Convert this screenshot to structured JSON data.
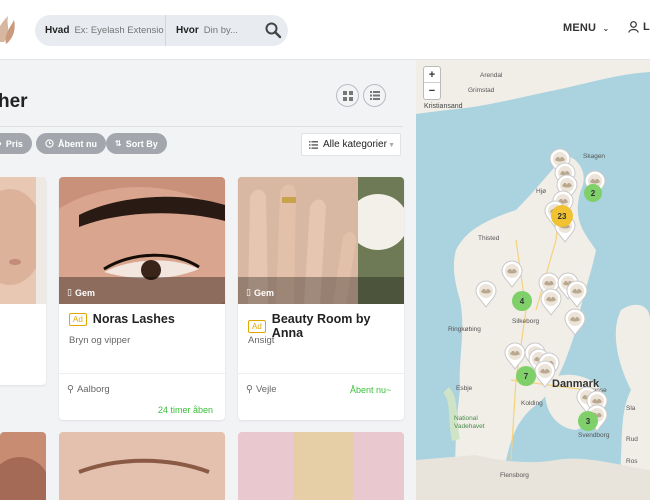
{
  "header": {
    "search": {
      "what_label": "Hvad",
      "what_placeholder": "Ex: Eyelash Extension",
      "where_label": "Hvor",
      "where_placeholder": "Din by..."
    },
    "menu_label": "MENU",
    "login_label": "L"
  },
  "page": {
    "title": "her",
    "filters": [
      {
        "label": "Pris",
        "icon": "price-icon"
      },
      {
        "label": "Åbent nu",
        "icon": "clock-icon"
      },
      {
        "label": "Sort By",
        "icon": "sort-icon"
      }
    ],
    "category_select": "Alle kategorier"
  },
  "cards": [
    {
      "save_label": "Gem",
      "ad_label": "Ad",
      "name": "Noras Lashes",
      "subtitle": "Bryn og vipper",
      "location": "Aalborg",
      "status": "24 timer åben"
    },
    {
      "save_label": "Gem",
      "ad_label": "Ad",
      "name": "Beauty Room by Anna",
      "subtitle": "Ansigt",
      "location": "Vejle",
      "status": "Åbent nu~"
    }
  ],
  "map": {
    "zoom_in": "+",
    "zoom_out": "−",
    "labels": [
      "Arendal",
      "Grimstad",
      "Kristiansand",
      "Skagen",
      "Hjø",
      "Thisted",
      "Silkeborg",
      "Ringkøbing",
      "Esbje",
      "Kolding",
      "National",
      "Vadehavet",
      "Flensborg",
      "Odense",
      "Svendborg",
      "Danmark",
      "Sla",
      "Rud",
      "Ros"
    ],
    "clusters": [
      "2",
      "23",
      "4",
      "7",
      "3"
    ]
  },
  "colors": {
    "accent_green": "#3bbf3b",
    "ad_yellow": "#e0a800",
    "pill_gray": "#a3a7ad",
    "map_sea": "#aad3df",
    "map_land": "#f1eee8"
  }
}
